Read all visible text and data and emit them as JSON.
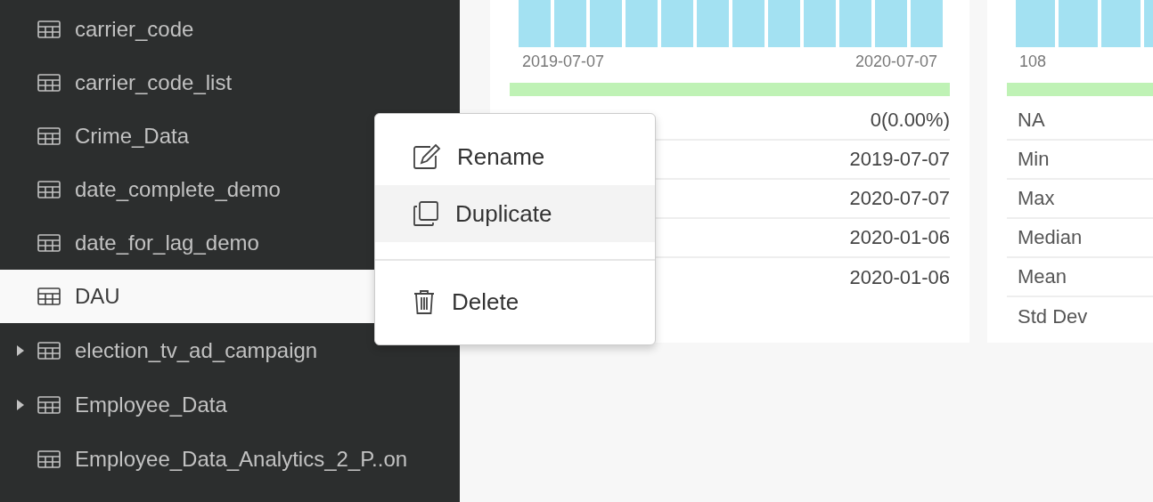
{
  "sidebar": {
    "items": [
      {
        "label": "carrier_code",
        "selected": false,
        "expandable": false
      },
      {
        "label": "carrier_code_list",
        "selected": false,
        "expandable": false
      },
      {
        "label": "Crime_Data",
        "selected": false,
        "expandable": false
      },
      {
        "label": "date_complete_demo",
        "selected": false,
        "expandable": false
      },
      {
        "label": "date_for_lag_demo",
        "selected": false,
        "expandable": false
      },
      {
        "label": "DAU",
        "selected": true,
        "expandable": false
      },
      {
        "label": "election_tv_ad_campaign",
        "selected": false,
        "expandable": true
      },
      {
        "label": "Employee_Data",
        "selected": false,
        "expandable": true
      },
      {
        "label": "Employee_Data_Analytics_2_P..on",
        "selected": false,
        "expandable": false
      }
    ]
  },
  "cards": [
    {
      "axis_labels": [
        "2019-07-07",
        "2020-07-07"
      ],
      "valid_bar": {
        "level": 1
      },
      "stats": [
        {
          "value": "0(0.00%)"
        },
        {
          "value": "2019-07-07"
        },
        {
          "value": "2020-07-07"
        },
        {
          "value": "2020-01-06"
        },
        {
          "value": "2020-01-06"
        }
      ]
    },
    {
      "axis_labels": [
        "108"
      ],
      "valid_bar": {
        "level": 1
      },
      "stats": [
        {
          "label": "NA"
        },
        {
          "label": "Min"
        },
        {
          "label": "Max"
        },
        {
          "label": "Median"
        },
        {
          "label": "Mean"
        },
        {
          "label": "Std Dev"
        }
      ]
    }
  ],
  "context_menu": {
    "items": [
      {
        "kind": "rename",
        "label": "Rename",
        "selected": false
      },
      {
        "kind": "duplicate",
        "label": "Duplicate",
        "selected": true
      },
      {
        "kind": "divider"
      },
      {
        "kind": "delete",
        "label": "Delete",
        "selected": false
      }
    ]
  }
}
